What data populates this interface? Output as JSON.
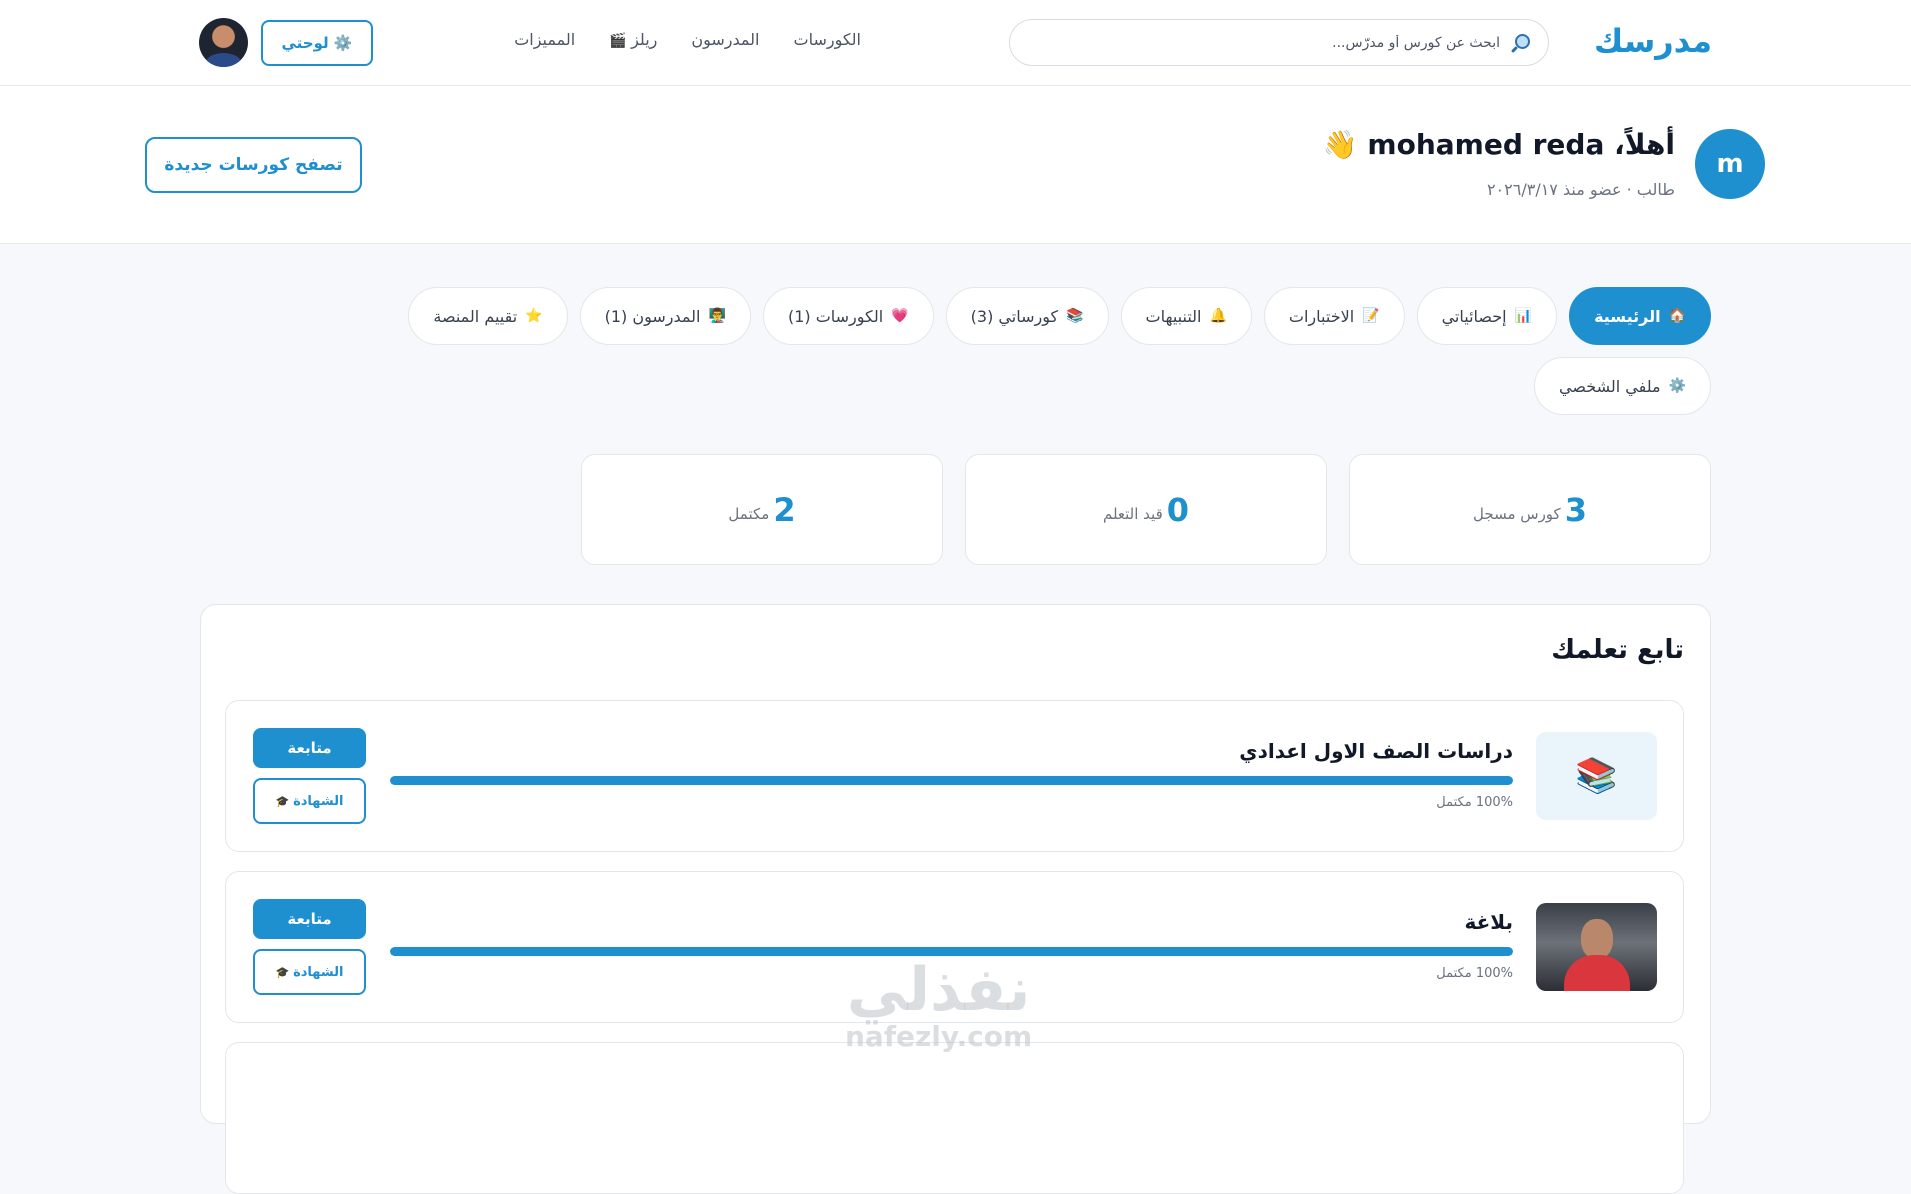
{
  "nav": {
    "logo": "مدرسك",
    "search_placeholder": "ابحث عن كورس أو مدرّس...",
    "links": [
      "الكورسات",
      "المدرسون",
      "ريلز",
      "المميزات"
    ],
    "dashboard_label": "⚙️ لوحتي"
  },
  "profile": {
    "initial": "m",
    "greeting": "أهلاً، mohamed reda 👋",
    "meta": "طالب · عضو منذ ٢٠٢٦/٣/١٧",
    "browse_label": "تصفح كورسات جديدة"
  },
  "tabs": [
    {
      "icon": "🏠",
      "label": "الرئيسية",
      "active": true
    },
    {
      "icon": "📊",
      "label": "إحصائياتي"
    },
    {
      "icon": "📝",
      "label": "الاختبارات"
    },
    {
      "icon": "🔔",
      "label": "التنبيهات"
    },
    {
      "icon": "📚",
      "label": "كورساتي (3)"
    },
    {
      "icon": "💗",
      "label": "الكورسات (1)"
    },
    {
      "icon": "👨‍🏫",
      "label": "المدرسون (1)"
    },
    {
      "icon": "⭐",
      "label": "تقييم المنصة"
    },
    {
      "icon": "⚙️",
      "label": "ملفي الشخصي"
    }
  ],
  "stats": [
    {
      "value": "3",
      "label": "كورس مسجل"
    },
    {
      "value": "0",
      "label": "قيد التعلم"
    },
    {
      "value": "2",
      "label": "مكتمل"
    }
  ],
  "continue": {
    "title": "تابع تعلمك",
    "courses": [
      {
        "title": "دراسات الصف الاول اعدادي",
        "progress": 100,
        "progress_text": "100% مكتمل",
        "follow_label": "متابعة",
        "cert_label": "الشهادة"
      },
      {
        "title": "بلاغة",
        "progress": 100,
        "progress_text": "100% مكتمل",
        "follow_label": "متابعة",
        "cert_label": "الشهادة"
      }
    ]
  },
  "watermark": {
    "ar": "نفذلي",
    "en": "nafezly.com"
  }
}
